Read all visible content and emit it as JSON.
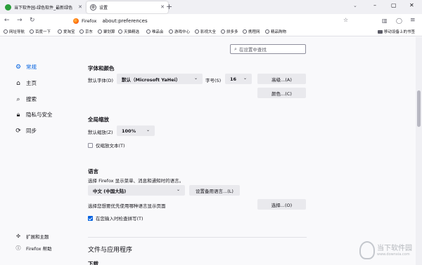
{
  "tabs": [
    {
      "title": "当下软件园-绿色软件_最新绿色",
      "active": false
    },
    {
      "title": "设置",
      "active": true
    }
  ],
  "toolbar": {
    "brand": "Firefox",
    "url": "about:preferences"
  },
  "bookmarks": {
    "items": [
      "网址导航",
      "百度一下",
      "爱淘宝",
      "京东",
      "聚划算",
      "天猫精选",
      "唯品会",
      "游戏中心",
      "影视大全",
      "拼多多",
      "携程网",
      "精品购物"
    ],
    "other": "移动设备上的书签"
  },
  "settings": {
    "search_placeholder": "在设置中查找",
    "categories": [
      {
        "label": "常规",
        "icon": "gear-icon",
        "selected": true
      },
      {
        "label": "主页",
        "icon": "home-icon",
        "selected": false
      },
      {
        "label": "搜索",
        "icon": "search-icon",
        "selected": false
      },
      {
        "label": "隐私与安全",
        "icon": "lock-icon",
        "selected": false
      },
      {
        "label": "同步",
        "icon": "sync-icon",
        "selected": false
      }
    ],
    "footer": [
      {
        "label": "扩展和主题",
        "icon": "puzzle-icon"
      },
      {
        "label": "Firefox 帮助",
        "icon": "help-icon"
      }
    ],
    "fonts": {
      "heading": "字体和颜色",
      "default_font_label": "默认字体(D)",
      "default_font_value": "默认（Microsoft YaHei）",
      "size_label": "字号(S)",
      "size_value": "16",
      "advanced_button": "高级...(A)",
      "colors_button": "颜色...(C)"
    },
    "zoom": {
      "heading": "全局缩放",
      "default_zoom_label": "默认缩放(Z)",
      "default_zoom_value": "100%",
      "text_only_label": "仅缩放文本(T)",
      "text_only_checked": false
    },
    "language": {
      "heading": "语言",
      "description": "选择 Firefox 显示菜单、消息和通知时的语言。",
      "language_value": "中文 (中国大陆)",
      "alternates_button": "设置备用语言...(L)",
      "page_language_label": "选择您想要优先使用哪种语言显示页面",
      "choose_button": "选择...(O)",
      "spellcheck_label": "在您输入时检查拼写(T)",
      "spellcheck_checked": true
    },
    "files_apps": {
      "heading": "文件与应用程序",
      "sub_heading": "下载"
    }
  },
  "watermark": {
    "title": "当下软件园",
    "url": "www.downxia.com"
  }
}
